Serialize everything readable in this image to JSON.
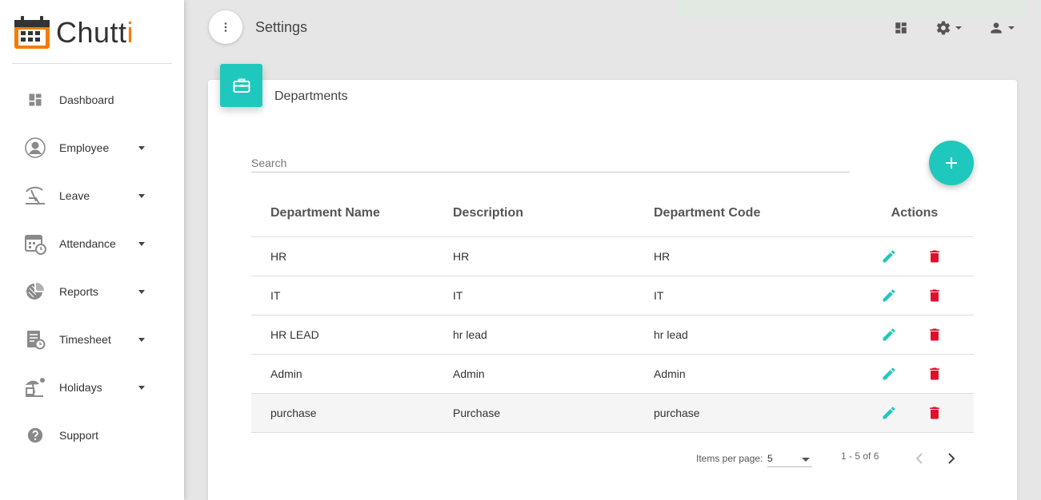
{
  "app": {
    "logo_text": "Chutt",
    "logo_accent": "i"
  },
  "sidebar": {
    "items": [
      {
        "label": "Dashboard",
        "icon": "dashboard-icon",
        "has_caret": false
      },
      {
        "label": "Employee",
        "icon": "person-icon",
        "has_caret": true
      },
      {
        "label": "Leave",
        "icon": "beach-chair-icon",
        "has_caret": true
      },
      {
        "label": "Attendance",
        "icon": "calendar-clock-icon",
        "has_caret": true
      },
      {
        "label": "Reports",
        "icon": "pie-chart-icon",
        "has_caret": true
      },
      {
        "label": "Timesheet",
        "icon": "timesheet-icon",
        "has_caret": true
      },
      {
        "label": "Holidays",
        "icon": "holiday-icon",
        "has_caret": true
      },
      {
        "label": "Support",
        "icon": "help-icon",
        "has_caret": false
      }
    ]
  },
  "header": {
    "title": "Settings"
  },
  "card": {
    "title": "Departments"
  },
  "search": {
    "placeholder": "Search"
  },
  "table": {
    "columns": [
      "Department Name",
      "Description",
      "Department Code",
      "Actions"
    ],
    "rows": [
      {
        "name": "HR",
        "description": "HR",
        "code": "HR"
      },
      {
        "name": "IT",
        "description": "IT",
        "code": "IT"
      },
      {
        "name": "HR LEAD",
        "description": "hr lead",
        "code": "hr lead"
      },
      {
        "name": "Admin",
        "description": "Admin",
        "code": "Admin"
      },
      {
        "name": "purchase",
        "description": "Purchase",
        "code": "purchase"
      }
    ]
  },
  "paginator": {
    "items_per_page_label": "Items per page:",
    "items_per_page_value": "5",
    "range_label": "1 - 5 of 6"
  },
  "colors": {
    "accent": "#1fc8bc",
    "delete": "#e0102a",
    "logo_orange": "#f57c00"
  }
}
